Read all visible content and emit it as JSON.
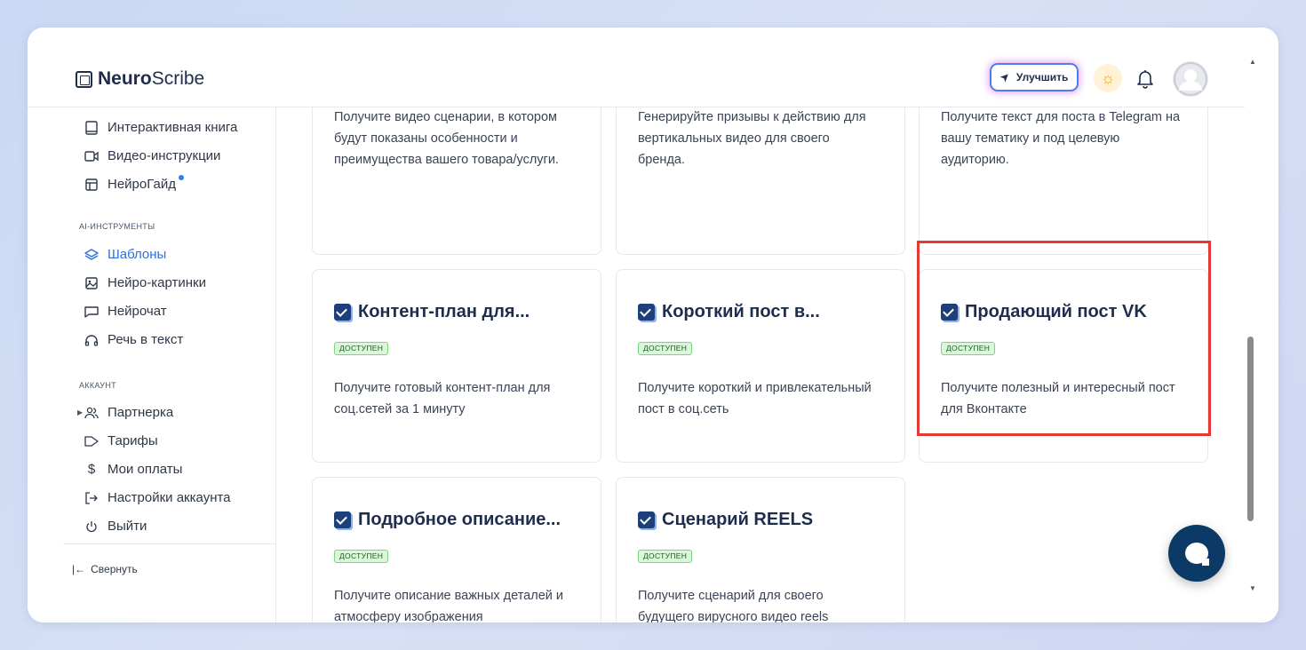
{
  "header": {
    "logo_bold": "Neuro",
    "logo_rest": "Scribe",
    "upgrade_label": "Улучшить"
  },
  "sidebar": {
    "items_top": [
      {
        "label": "Интерактивная книга",
        "icon": "book-icon"
      },
      {
        "label": "Видео-инструкции",
        "icon": "video-icon"
      },
      {
        "label": "НейроГайд",
        "icon": "table-icon"
      }
    ],
    "section_ai": "AI-инструменты",
    "items_ai": [
      {
        "label": "Шаблоны",
        "icon": "layers-icon"
      },
      {
        "label": "Нейро-картинки",
        "icon": "image-icon"
      },
      {
        "label": "Нейрочат",
        "icon": "chat-icon"
      },
      {
        "label": "Речь в текст",
        "icon": "headphones-icon"
      }
    ],
    "section_account": "Аккаунт",
    "items_account": [
      {
        "label": "Партнерка",
        "icon": "users-icon"
      },
      {
        "label": "Тарифы",
        "icon": "tag-icon"
      },
      {
        "label": "Мои оплаты",
        "icon": "dollar-icon"
      },
      {
        "label": "Настройки аккаунта",
        "icon": "login-icon"
      },
      {
        "label": "Выйти",
        "icon": "power-icon"
      }
    ],
    "collapse_label": "Свернуть"
  },
  "cards_top": [
    {
      "desc": "Получите видео сценарии, в котором будут показаны особенности и преимущества вашего товара/услуги."
    },
    {
      "desc": "Генерируйте призывы к действию для вертикальных видео для своего бренда."
    },
    {
      "desc": "Получите текст для поста в Telegram на вашу тематику и под целевую аудиторию."
    }
  ],
  "cards": [
    {
      "title": "Контент-план для...",
      "badge": "доступен",
      "desc": "Получите готовый контент-план для соц.сетей за 1 минуту"
    },
    {
      "title": "Короткий пост в...",
      "badge": "доступен",
      "desc": "Получите короткий и привлекательный пост в соц.сеть"
    },
    {
      "title": "Продающий пост VK",
      "badge": "доступен",
      "desc": "Получите полезный и интересный пост для Вконтакте"
    },
    {
      "title": "Подробное описание...",
      "badge": "доступен",
      "desc": "Получите описание важных деталей и атмосферу изображения"
    },
    {
      "title": "Сценарий REELS",
      "badge": "доступен",
      "desc": "Получите сценарий для своего будущего вирусного видео reels"
    }
  ],
  "colors": {
    "accent": "#2f6fd8",
    "highlight": "#e53935",
    "badge_bg": "#d9f7d9",
    "chat_button": "#0c3a66"
  }
}
